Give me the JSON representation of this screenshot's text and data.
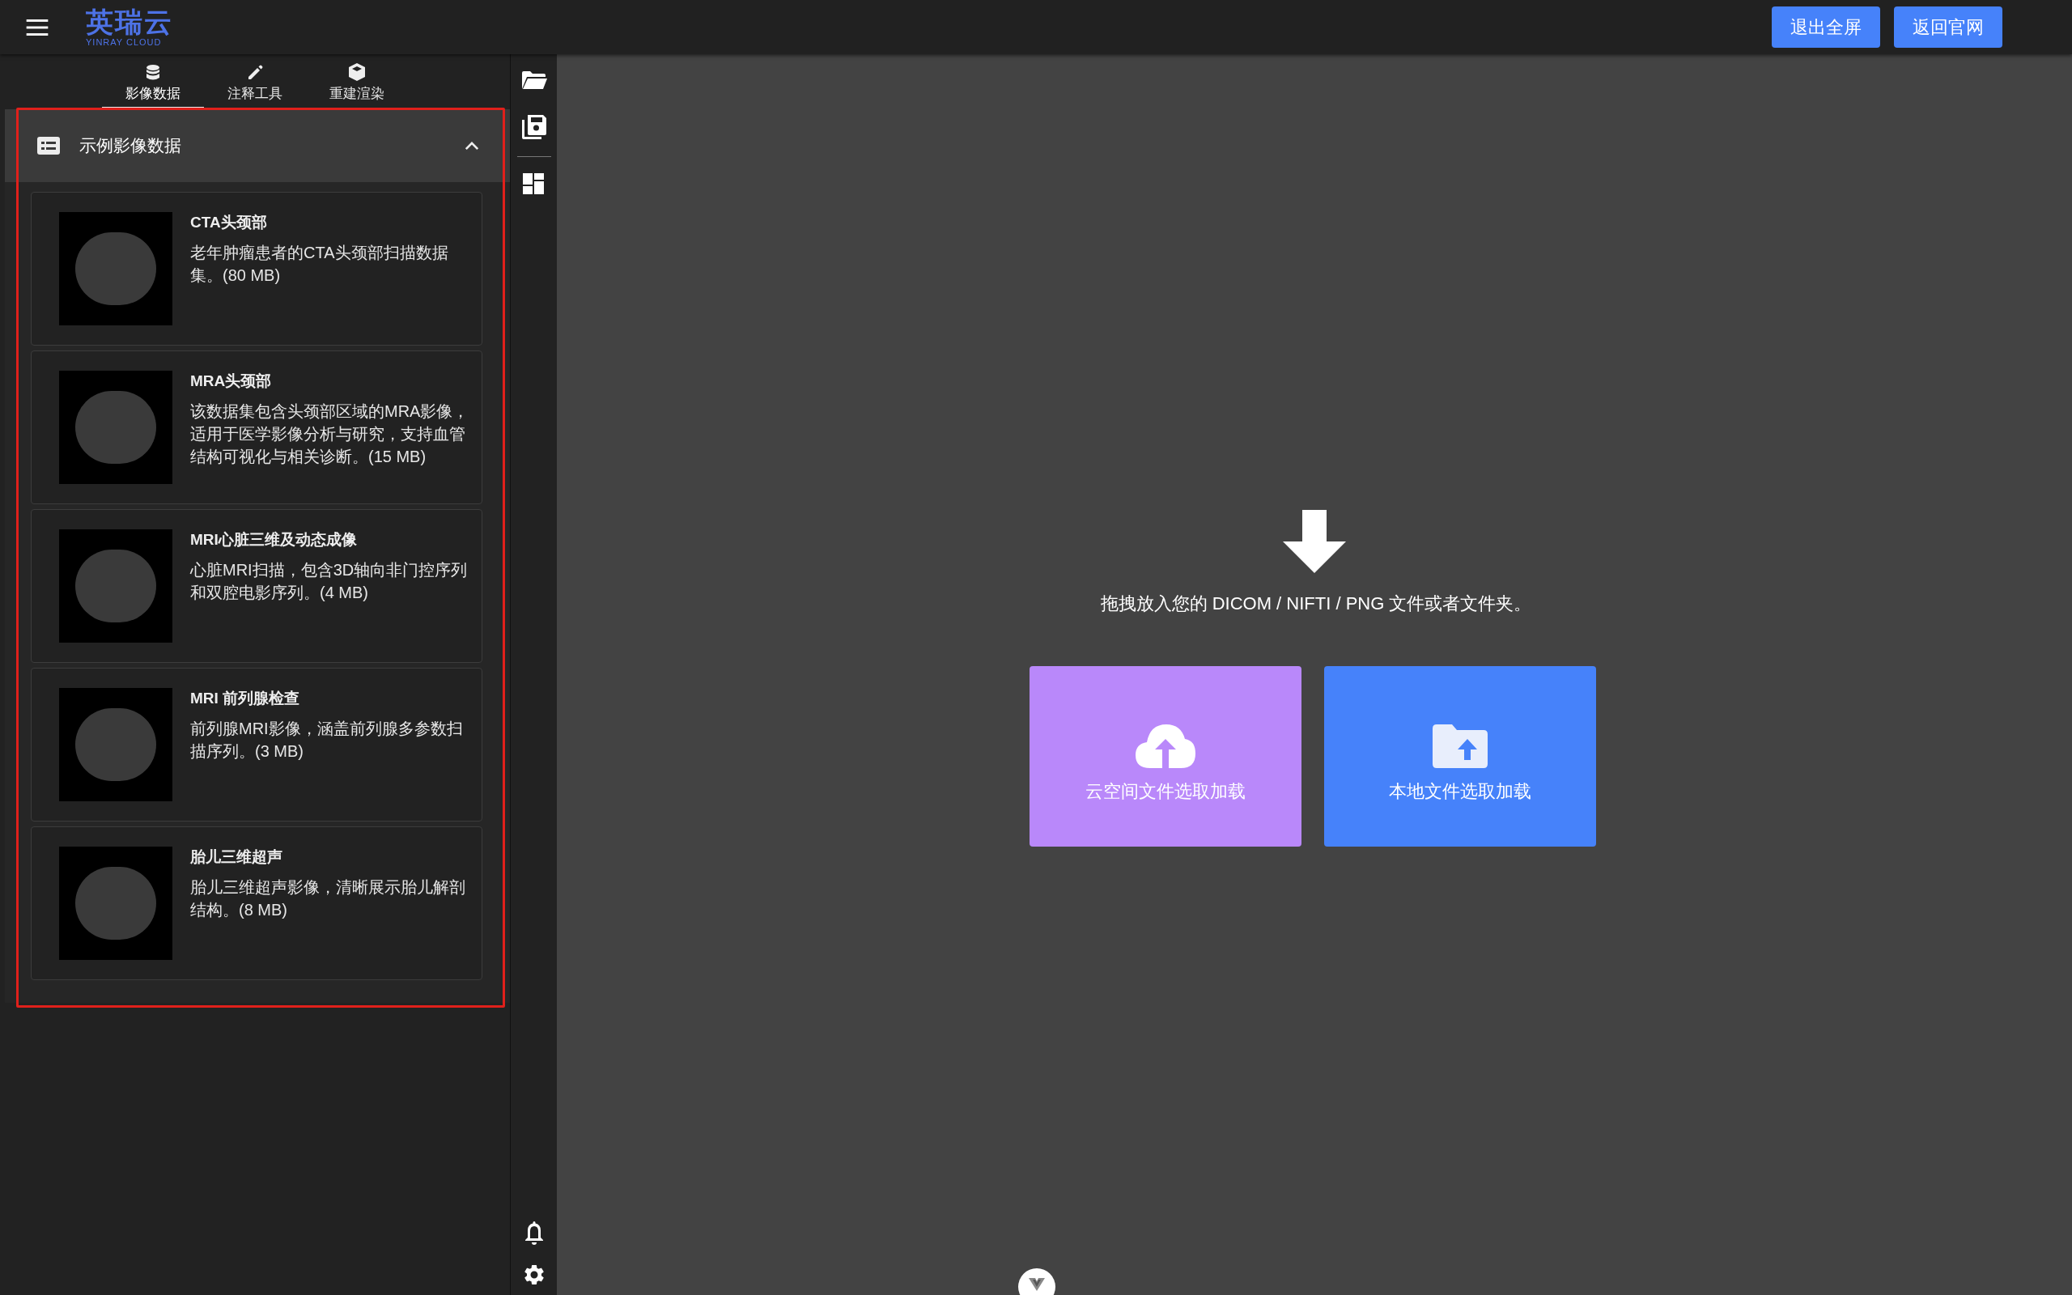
{
  "header": {
    "logo": {
      "name": "英瑞云",
      "subtitle": "YINRAY CLOUD"
    },
    "buttons": [
      "退出全屏",
      "返回官网"
    ]
  },
  "tabs": [
    {
      "label": "影像数据",
      "kind": "data",
      "selected": true
    },
    {
      "label": "注释工具",
      "kind": "annotate",
      "selected": false
    },
    {
      "label": "重建渲染",
      "kind": "render",
      "selected": false
    }
  ],
  "panel": {
    "title": "示例影像数据",
    "expanded": true,
    "items": [
      {
        "title": "CTA头颈部",
        "description": "老年肿瘤患者的CTA头颈部扫描数据集。(80 MB)"
      },
      {
        "title": "MRA头颈部",
        "description": "该数据集包含头颈部区域的MRA影像，适用于医学影像分析与研究，支持血管结构可视化与相关诊断。(15 MB)"
      },
      {
        "title": "MRI心脏三维及动态成像",
        "description": "心脏MRI扫描，包含3D轴向非门控序列和双腔电影序列。(4 MB)"
      },
      {
        "title": "MRI 前列腺检查",
        "description": "前列腺MRI影像，涵盖前列腺多参数扫描序列。(3 MB)"
      },
      {
        "title": "胎儿三维超声",
        "description": "胎儿三维超声影像，清晰展示胎儿解剖结构。(8 MB)"
      }
    ]
  },
  "dropzone": {
    "hint": "拖拽放入您的 DICOM / NIFTI / PNG 文件或者文件夹。",
    "actions": [
      {
        "label": "云空间文件选取加载",
        "kind": "cloud"
      },
      {
        "label": "本地文件选取加载",
        "kind": "local"
      }
    ]
  }
}
